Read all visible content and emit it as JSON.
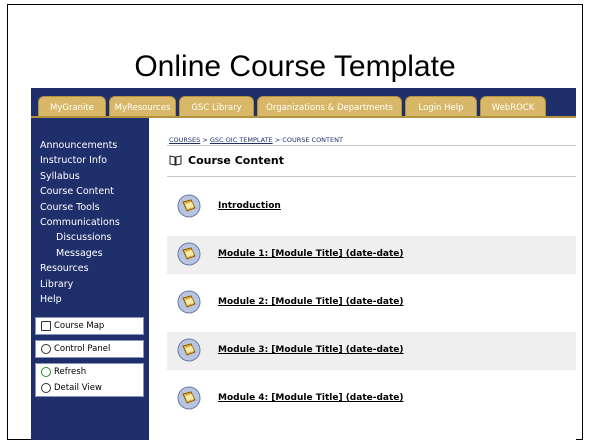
{
  "slide": {
    "title": "Online Course Template"
  },
  "tabs": [
    "MyGranite",
    "MyResources",
    "GSC Library",
    "Organizations & Departments",
    "Login Help",
    "WebROCK"
  ],
  "sidebar": {
    "items": [
      {
        "label": "Announcements",
        "sub": false
      },
      {
        "label": "Instructor Info",
        "sub": false
      },
      {
        "label": "Syllabus",
        "sub": false
      },
      {
        "label": "Course Content",
        "sub": false
      },
      {
        "label": "Course Tools",
        "sub": false
      },
      {
        "label": "Communications",
        "sub": false
      },
      {
        "label": "Discussions",
        "sub": true
      },
      {
        "label": "Messages",
        "sub": true
      },
      {
        "label": "Resources",
        "sub": false
      },
      {
        "label": "Library",
        "sub": false
      },
      {
        "label": "Help",
        "sub": false
      }
    ],
    "course_map": "Course Map",
    "control_panel": "Control Panel",
    "refresh": "Refresh",
    "detail_view": "Detail View"
  },
  "breadcrumb": {
    "courses": "COURSES",
    "template": "GSC OIC TEMPLATE",
    "current": "COURSE CONTENT",
    "sep": " > "
  },
  "page": {
    "title": "Course Content"
  },
  "content_items": [
    "Introduction",
    "Module 1: [Module Title] (date-date)",
    "Module 2: [Module Title] (date-date)",
    "Module 3: [Module Title] (date-date)",
    "Module 4: [Module Title] (date-date)"
  ],
  "colors": {
    "nav_bg": "#1f2f6b",
    "tab_bg": "#d8b868",
    "row_alt": "#efefef"
  }
}
